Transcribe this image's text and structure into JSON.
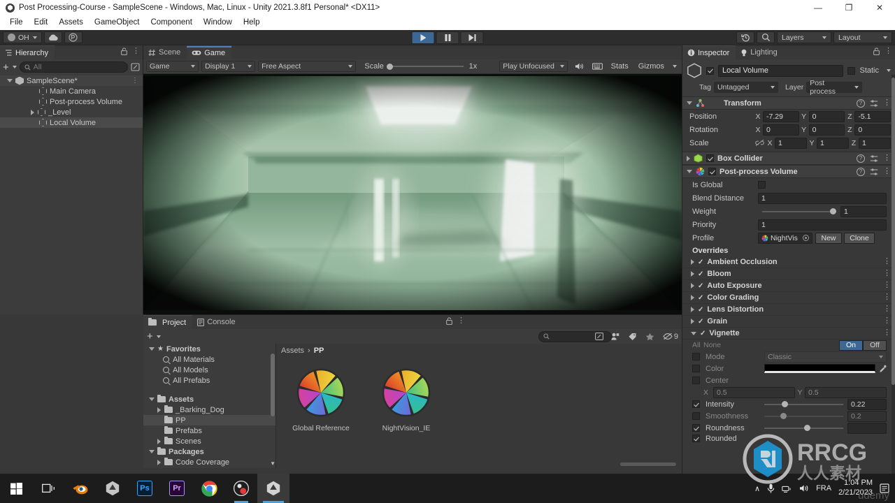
{
  "window": {
    "title": "Post Processing-Course - SampleScene - Windows, Mac, Linux - Unity 2021.3.8f1 Personal* <DX11>",
    "minimize": "—",
    "maximize": "❐",
    "close": "✕"
  },
  "menu": {
    "items": [
      "File",
      "Edit",
      "Assets",
      "GameObject",
      "Component",
      "Window",
      "Help"
    ]
  },
  "toolbar": {
    "account": "OH",
    "cloud_icon": "cloud-icon",
    "collab_icon": "collab-icon",
    "play_icon": "play-icon",
    "pause_icon": "pause-icon",
    "step_icon": "step-icon",
    "undo_history_icon": "undo-history-icon",
    "search_icon": "search-icon",
    "layers": "Layers",
    "layout": "Layout"
  },
  "hierarchy": {
    "tab": "Hierarchy",
    "lock_icon": "lock-icon",
    "menu_icon": "kebab-menu-icon",
    "add_label": "+",
    "search_placeholder": "All",
    "items": [
      {
        "label": "SampleScene*",
        "indent": 1,
        "icon": "scene-icon",
        "expander": "down",
        "selected": false
      },
      {
        "label": "Main Camera",
        "indent": 3,
        "icon": "gameobject-icon",
        "expander": "none",
        "selected": false
      },
      {
        "label": "Post-process Volume",
        "indent": 3,
        "icon": "gameobject-icon",
        "expander": "none",
        "selected": false
      },
      {
        "label": "_Level",
        "indent": 2,
        "icon": "gameobject-icon",
        "expander": "right",
        "selected": false
      },
      {
        "label": "Local Volume",
        "indent": 3,
        "icon": "gameobject-icon",
        "expander": "none",
        "selected": true
      }
    ]
  },
  "center": {
    "tabs": [
      {
        "label": "Scene",
        "icon": "scene-grid-icon",
        "active": false
      },
      {
        "label": "Game",
        "icon": "gamepad-icon",
        "active": true
      }
    ],
    "game_toolbar": {
      "view_mode": "Game",
      "display": "Display 1",
      "aspect": "Free Aspect",
      "scale_label": "Scale",
      "scale_value": "1x",
      "play_mode": "Play Unfocused",
      "mute_icon": "mute-audio-icon",
      "stats_icon": "render-doc-icon",
      "stats": "Stats",
      "gizmos": "Gizmos"
    }
  },
  "project": {
    "tabs": [
      {
        "label": "Project",
        "icon": "folder-icon",
        "active": true
      },
      {
        "label": "Console",
        "icon": "console-icon",
        "active": false
      }
    ],
    "lock_icon": "lock-icon",
    "menu_icon": "kebab-menu-icon",
    "add_label": "+",
    "search_placeholder": "",
    "filter_badge": "9",
    "tree": [
      {
        "label": "Favorites",
        "indent": 0,
        "icon": "star-icon",
        "expander": "down",
        "selected": false
      },
      {
        "label": "All Materials",
        "indent": 1,
        "icon": "search-icon",
        "expander": "none",
        "selected": false
      },
      {
        "label": "All Models",
        "indent": 1,
        "icon": "search-icon",
        "expander": "none",
        "selected": false
      },
      {
        "label": "All Prefabs",
        "indent": 1,
        "icon": "search-icon",
        "expander": "none",
        "selected": false
      },
      {
        "label": "",
        "indent": 0,
        "icon": "none",
        "expander": "none",
        "selected": false
      },
      {
        "label": "Assets",
        "indent": 0,
        "icon": "folder-icon",
        "expander": "down",
        "selected": false
      },
      {
        "label": "_Barking_Dog",
        "indent": 1,
        "icon": "folder-icon",
        "expander": "right",
        "selected": false
      },
      {
        "label": "PP",
        "indent": 1,
        "icon": "folder-icon",
        "expander": "none",
        "selected": true
      },
      {
        "label": "Prefabs",
        "indent": 1,
        "icon": "folder-icon",
        "expander": "none",
        "selected": false
      },
      {
        "label": "Scenes",
        "indent": 1,
        "icon": "folder-icon",
        "expander": "right",
        "selected": false
      },
      {
        "label": "Packages",
        "indent": 0,
        "icon": "folder-icon",
        "expander": "down",
        "selected": false
      },
      {
        "label": "Code Coverage",
        "indent": 1,
        "icon": "folder-icon",
        "expander": "right",
        "selected": false
      }
    ],
    "breadcrumb": [
      "Assets",
      "PP"
    ],
    "breadcrumb_sep": "›",
    "assets": [
      {
        "label": "Global Reference",
        "icon": "post-process-profile-icon"
      },
      {
        "label": "NightVision_IE",
        "icon": "post-process-profile-icon"
      }
    ]
  },
  "inspector": {
    "tabs": [
      {
        "label": "Inspector",
        "icon": "info-icon",
        "active": true
      },
      {
        "label": "Lighting",
        "icon": "lightbulb-icon",
        "active": false
      }
    ],
    "lock_icon": "lock-icon",
    "menu_icon": "kebab-menu-icon",
    "object": {
      "enabled": true,
      "name": "Local Volume",
      "static_label": "Static",
      "tag_label": "Tag",
      "tag_value": "Untagged",
      "layer_label": "Layer",
      "layer_value": "Post process"
    },
    "transform": {
      "title": "Transform",
      "rows": [
        {
          "name": "Position",
          "x": "-7.29",
          "y": "0",
          "z": "-5.1"
        },
        {
          "name": "Rotation",
          "x": "0",
          "y": "0",
          "z": "0"
        },
        {
          "name": "Scale",
          "x": "1",
          "y": "1",
          "z": "1"
        }
      ],
      "axis_labels": [
        "X",
        "Y",
        "Z"
      ],
      "scale_link_icon": "link-broken-icon"
    },
    "box_collider": {
      "title": "Box Collider",
      "enabled": true,
      "expanded": false
    },
    "ppvolume": {
      "title": "Post-process Volume",
      "enabled": true,
      "is_global_label": "Is Global",
      "is_global_value": false,
      "blend_distance_label": "Blend Distance",
      "blend_distance_value": "1",
      "weight_label": "Weight",
      "weight_value": "1",
      "priority_label": "Priority",
      "priority_value": "1",
      "profile_label": "Profile",
      "profile_value": "NightVis",
      "new_button": "New",
      "clone_button": "Clone",
      "overrides_label": "Overrides",
      "overrides": [
        {
          "label": "Ambient Occlusion",
          "checked": true,
          "expanded": false
        },
        {
          "label": "Bloom",
          "checked": true,
          "expanded": false
        },
        {
          "label": "Auto Exposure",
          "checked": true,
          "expanded": false
        },
        {
          "label": "Color Grading",
          "checked": true,
          "expanded": false
        },
        {
          "label": "Lens Distortion",
          "checked": true,
          "expanded": false
        },
        {
          "label": "Grain",
          "checked": true,
          "expanded": false
        },
        {
          "label": "Vignette",
          "checked": true,
          "expanded": true
        }
      ]
    },
    "vignette": {
      "all_label": "All",
      "none_label": "None",
      "on_label": "On",
      "off_label": "Off",
      "rows": [
        {
          "name": "Mode",
          "checked": false,
          "value": "Classic",
          "kind": "dropdown"
        },
        {
          "name": "Color",
          "checked": false,
          "value": "#000000",
          "kind": "color"
        },
        {
          "name": "Center",
          "checked": false,
          "value": "",
          "kind": "label"
        },
        {
          "name": "Center XY",
          "checked": false,
          "value": "",
          "kind": "vector2",
          "x": "0.5",
          "y": "0.5"
        },
        {
          "name": "Intensity",
          "checked": true,
          "value": "0.22",
          "kind": "slider",
          "pos": 0.22
        },
        {
          "name": "Smoothness",
          "checked": false,
          "value": "0.2",
          "kind": "slider",
          "pos": 0.2
        },
        {
          "name": "Roundness",
          "checked": true,
          "value": "",
          "kind": "slider",
          "pos": 0.5
        },
        {
          "name": "Rounded",
          "checked": true,
          "value": "",
          "kind": "toggle"
        }
      ],
      "eyedropper_icon": "eyedropper-icon"
    }
  },
  "taskbar": {
    "apps": [
      {
        "name": "start-button",
        "icon": "windows-logo-icon"
      },
      {
        "name": "task-view-button",
        "icon": "task-view-icon"
      },
      {
        "name": "blender-app",
        "icon": "blender-icon"
      },
      {
        "name": "unity-hub-app",
        "icon": "unity-hub-icon"
      },
      {
        "name": "photoshop-app",
        "icon": "photoshop-icon",
        "label": "Ps"
      },
      {
        "name": "premiere-app",
        "icon": "premiere-icon",
        "label": "Pr"
      },
      {
        "name": "chrome-app",
        "icon": "chrome-icon"
      },
      {
        "name": "obs-app",
        "icon": "obs-icon"
      },
      {
        "name": "unity-editor-app",
        "icon": "unity-icon"
      }
    ],
    "tray": {
      "chevron": "∧",
      "mic_icon": "microphone-icon",
      "network_icon": "network-icon",
      "volume_icon": "volume-icon",
      "language": "FRA",
      "time": "1:04 PM",
      "date": "2/21/2023",
      "notification_icon": "notifications-icon"
    }
  },
  "watermarks": {
    "rrcg": "RRCG",
    "rrcg_cn": "人人素材",
    "udemy": "udemy"
  },
  "colors": {
    "accent_blue": "#3e6894",
    "panel_bg": "#383838",
    "panel_light": "#3c3c3c",
    "taskbar_accent": "#4aa3e0",
    "nightvision_green": "#8fbf9a"
  }
}
